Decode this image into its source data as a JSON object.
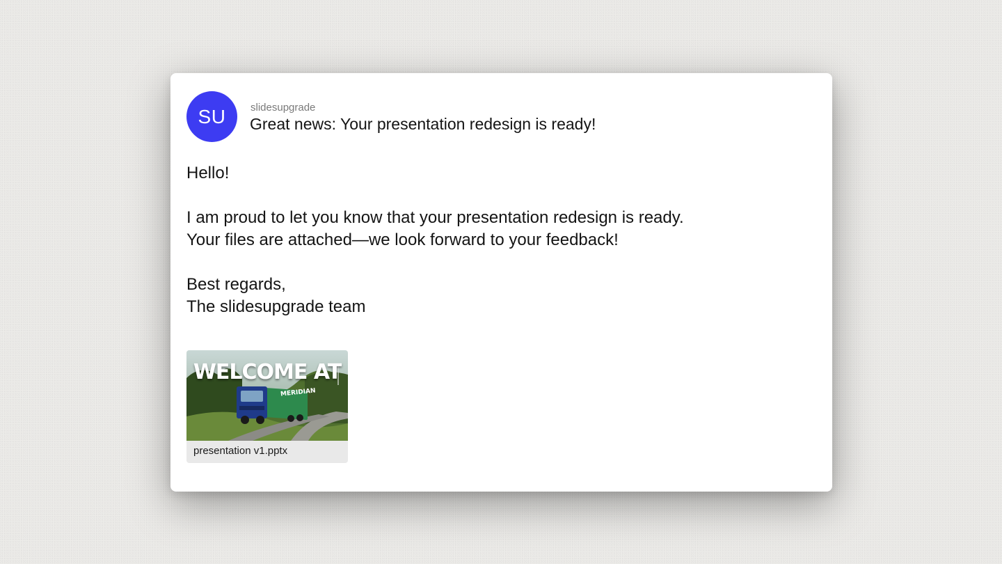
{
  "email": {
    "avatar_initials": "SU",
    "avatar_color": "#3d3cf2",
    "sender": "slidesupgrade",
    "subject": "Great news: Your presentation redesign is ready!",
    "body": {
      "greeting": "Hello!",
      "line1": "I am proud to let you know that your presentation redesign is ready.",
      "line2": "Your files are attached—we look forward to your feedback!",
      "closing": "Best regards,",
      "signature": "The slidesupgrade team"
    },
    "attachment": {
      "thumbnail_title": "WELCOME AT",
      "thumbnail_brand": "MERIDIAN",
      "filename": "presentation v1.pptx"
    }
  }
}
